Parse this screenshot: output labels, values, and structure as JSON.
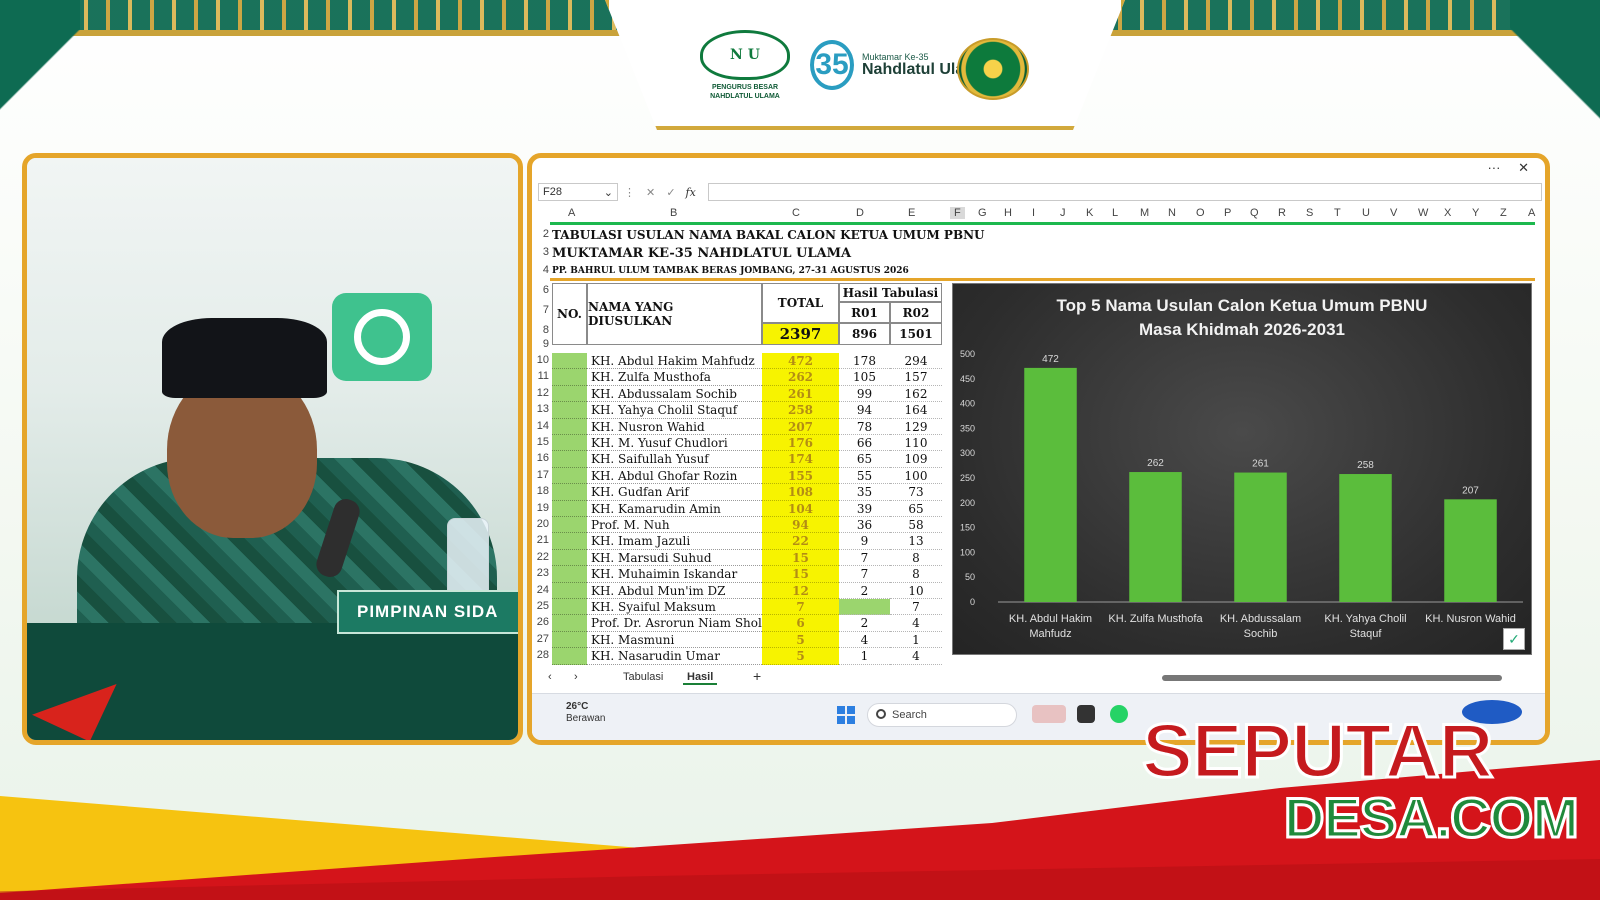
{
  "branding": {
    "nu_logo_caption": "PENGURUS BESAR NAHDLATUL ULAMA",
    "muktamar_small": "Muktamar Ke-35",
    "muktamar_big": "Nahdlatul Ulama",
    "muktamar_number": "35",
    "nameplate": "PIMPINAN SIDA"
  },
  "window": {
    "more_label": "···",
    "close_label": "✕"
  },
  "formula_bar": {
    "cell_ref": "F28",
    "fx_label": "fx",
    "formula_value": ""
  },
  "columns": [
    "A",
    "B",
    "C",
    "D",
    "E",
    "F",
    "G",
    "H",
    "I",
    "J",
    "K",
    "L",
    "M",
    "N",
    "O",
    "P",
    "Q",
    "R",
    "S",
    "T",
    "U",
    "V",
    "W",
    "X",
    "Y",
    "Z",
    "A"
  ],
  "row_numbers": [
    "2",
    "3",
    "4",
    "6",
    "7",
    "8",
    "9",
    "10",
    "11",
    "12",
    "13",
    "14",
    "15",
    "16",
    "17",
    "18",
    "19",
    "20",
    "21",
    "22",
    "23",
    "24",
    "25",
    "26",
    "27",
    "28"
  ],
  "sheet": {
    "title1": "TABULASI USULAN NAMA BAKAL CALON KETUA UMUM PBNU",
    "title2": "MUKTAMAR KE-35 NAHDLATUL ULAMA",
    "title3": "PP. BAHRUL ULUM TAMBAK BERAS JOMBANG, 27-31 AGUSTUS 2026",
    "hdr_no": "NO.",
    "hdr_name": "NAMA YANG DIUSULKAN",
    "hdr_total": "TOTAL",
    "hdr_hasil": "Hasil Tabulasi",
    "hdr_r01": "R01",
    "hdr_r02": "R02",
    "sum_total": "2397",
    "sum_r01": "896",
    "sum_r02": "1501",
    "rows": [
      {
        "name": "KH. Abdul Hakim Mahfudz",
        "total": "472",
        "r01": "178",
        "r02": "294"
      },
      {
        "name": "KH. Zulfa Musthofa",
        "total": "262",
        "r01": "105",
        "r02": "157"
      },
      {
        "name": "KH. Abdussalam Sochib",
        "total": "261",
        "r01": "99",
        "r02": "162"
      },
      {
        "name": "KH. Yahya Cholil Staquf",
        "total": "258",
        "r01": "94",
        "r02": "164"
      },
      {
        "name": "KH. Nusron Wahid",
        "total": "207",
        "r01": "78",
        "r02": "129"
      },
      {
        "name": "KH. M. Yusuf Chudlori",
        "total": "176",
        "r01": "66",
        "r02": "110"
      },
      {
        "name": "KH. Saifullah Yusuf",
        "total": "174",
        "r01": "65",
        "r02": "109"
      },
      {
        "name": "KH. Abdul Ghofar Rozin",
        "total": "155",
        "r01": "55",
        "r02": "100"
      },
      {
        "name": "KH. Gudfan Arif",
        "total": "108",
        "r01": "35",
        "r02": "73"
      },
      {
        "name": "KH. Kamarudin Amin",
        "total": "104",
        "r01": "39",
        "r02": "65"
      },
      {
        "name": "Prof. M. Nuh",
        "total": "94",
        "r01": "36",
        "r02": "58"
      },
      {
        "name": "KH. Imam Jazuli",
        "total": "22",
        "r01": "9",
        "r02": "13"
      },
      {
        "name": "KH. Marsudi Suhud",
        "total": "15",
        "r01": "7",
        "r02": "8"
      },
      {
        "name": "KH. Muhaimin Iskandar",
        "total": "15",
        "r01": "7",
        "r02": "8"
      },
      {
        "name": "KH. Abdul Mun'im DZ",
        "total": "12",
        "r01": "2",
        "r02": "10"
      },
      {
        "name": "KH. Syaiful Maksum",
        "total": "7",
        "r01": "",
        "r02": "7"
      },
      {
        "name": "Prof. Dr. Asrorun Niam Sholeh",
        "total": "6",
        "r01": "2",
        "r02": "4"
      },
      {
        "name": "KH. Masmuni",
        "total": "5",
        "r01": "4",
        "r02": "1"
      },
      {
        "name": "KH. Nasarudin Umar",
        "total": "5",
        "r01": "1",
        "r02": "4"
      }
    ]
  },
  "chart_data": {
    "type": "bar",
    "title": "Top 5 Nama Usulan Calon Ketua Umum PBNU Masa Khidmah 2026-2031",
    "title_line1": "Top 5 Nama Usulan Calon Ketua Umum PBNU",
    "title_line2": "Masa Khidmah 2026-2031",
    "categories": [
      "KH. Abdul Hakim Mahfudz",
      "KH. Zulfa Musthofa",
      "KH. Abdussalam Sochib",
      "KH. Yahya Cholil Staquf",
      "KH. Nusron Wahid"
    ],
    "values": [
      472,
      262,
      261,
      258,
      207
    ],
    "yticks": [
      0,
      50,
      100,
      150,
      200,
      250,
      300,
      350,
      400,
      450,
      500
    ],
    "ylim": [
      0,
      500
    ],
    "bar_color": "#5bbd3c",
    "grid": false,
    "legend": "none"
  },
  "tabs": [
    "Tabulasi",
    "Hasil"
  ],
  "active_tab": "Hasil",
  "add_tab_label": "+",
  "taskbar": {
    "temperature": "26°C",
    "weather": "Berawan",
    "search_label": "Search"
  },
  "watermark": {
    "line1": "SEPUTAR",
    "line2": "DESA.COM"
  },
  "colors": {
    "frame_gold": "#e5a52a",
    "nu_green": "#0e6b52",
    "total_yellow": "#f7f300",
    "no_green": "#9bd56e",
    "brand_red": "#d4141a"
  }
}
